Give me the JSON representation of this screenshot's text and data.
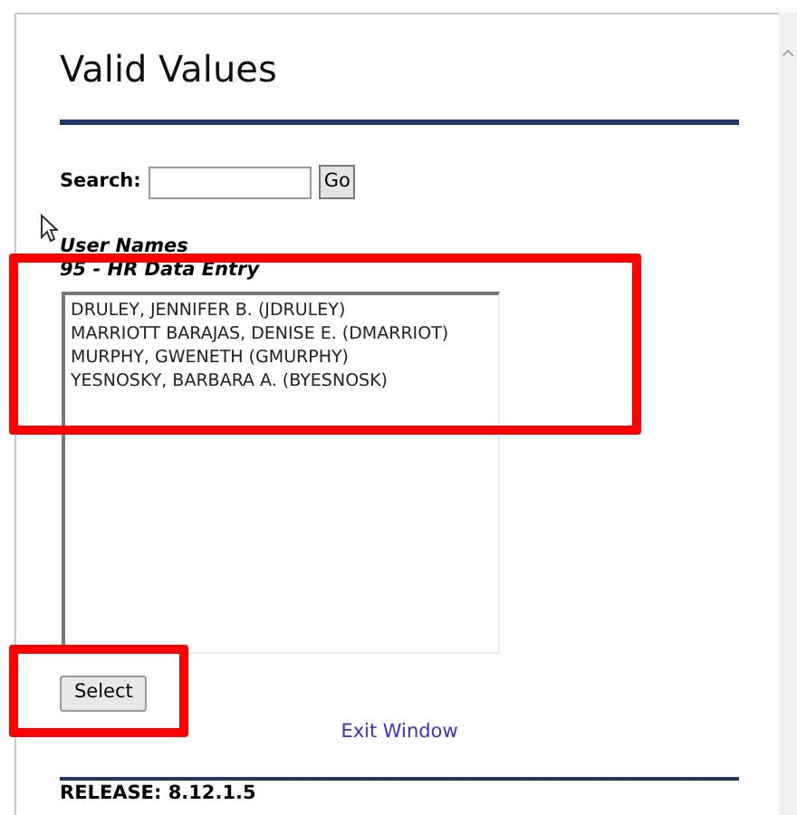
{
  "title": "Valid Values",
  "search": {
    "label": "Search:",
    "button": "Go"
  },
  "list_heading": "User Names",
  "group_label": "95 - HR Data Entry",
  "options": [
    "DRULEY, JENNIFER B. (JDRULEY)",
    "MARRIOTT BARAJAS, DENISE E. (DMARRIOT)",
    "MURPHY, GWENETH (GMURPHY)",
    "YESNOSKY, BARBARA A. (BYESNOSK)"
  ],
  "select_button": "Select",
  "exit_link": "Exit Window",
  "release": "RELEASE: 8.12.1.5"
}
